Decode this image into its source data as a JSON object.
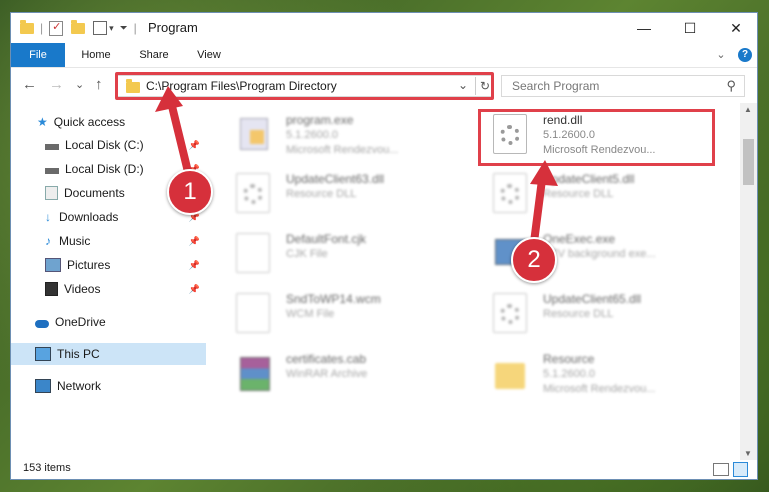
{
  "window": {
    "title": "Program",
    "controls": {
      "minimize": "—",
      "maximize": "☐",
      "close": "✕"
    }
  },
  "ribbon": {
    "tabs": [
      "File",
      "Home",
      "Share",
      "View"
    ],
    "expand": "⌄",
    "help": "?"
  },
  "nav": {
    "back": "←",
    "forward": "→",
    "recent": "⌄",
    "up": "↑",
    "address": "C:\\Program Files\\Program Directory",
    "refresh": "↻",
    "search_placeholder": "Search Program"
  },
  "sidebar": {
    "items": [
      {
        "label": "Quick access",
        "icon": "star-icon",
        "pinned": false
      },
      {
        "label": "Local Disk (C:)",
        "icon": "drive-icon",
        "pinned": true
      },
      {
        "label": "Local Disk (D:)",
        "icon": "drive-icon",
        "pinned": true
      },
      {
        "label": "Documents",
        "icon": "documents-icon",
        "pinned": true
      },
      {
        "label": "Downloads",
        "icon": "download-icon",
        "pinned": true
      },
      {
        "label": "Music",
        "icon": "music-icon",
        "pinned": true
      },
      {
        "label": "Pictures",
        "icon": "pictures-icon",
        "pinned": true
      },
      {
        "label": "Videos",
        "icon": "video-icon",
        "pinned": true
      },
      {
        "label": "OneDrive",
        "icon": "cloud-icon",
        "pinned": false
      },
      {
        "label": "This PC",
        "icon": "computer-icon",
        "pinned": false,
        "selected": true
      },
      {
        "label": "Network",
        "icon": "network-icon",
        "pinned": false
      }
    ]
  },
  "files": [
    {
      "name": "program.exe",
      "line1": "5.1.2600.0",
      "line2": "Microsoft Rendezvou...",
      "type": "exe"
    },
    {
      "name": "rend.dll",
      "line1": "5.1.2600.0",
      "line2": "Microsoft Rendezvou...",
      "type": "dll"
    },
    {
      "name": "UpdateClient63.dll",
      "line1": "Resource DLL",
      "line2": "",
      "type": "dll"
    },
    {
      "name": "UpdateClient5.dll",
      "line1": "Resource DLL",
      "line2": "",
      "type": "dll"
    },
    {
      "name": "DefaultFont.cjk",
      "line1": "CJK File",
      "line2": "",
      "type": "doc"
    },
    {
      "name": "OneExec.exe",
      "line1": "DTV background exe...",
      "line2": "",
      "type": "exe2"
    },
    {
      "name": "SndToWP14.wcm",
      "line1": "WCM File",
      "line2": "",
      "type": "doc"
    },
    {
      "name": "UpdateClient65.dll",
      "line1": "Resource DLL",
      "line2": "",
      "type": "dll"
    },
    {
      "name": "certificates.cab",
      "line1": "WinRAR Archive",
      "line2": "",
      "type": "rar"
    },
    {
      "name": "Resource",
      "line1": "5.1.2600.0",
      "line2": "Microsoft Rendezvou...",
      "type": "folder"
    }
  ],
  "status": {
    "count": "153 items"
  },
  "callouts": {
    "one": "1",
    "two": "2"
  },
  "colors": {
    "accent": "#1979ca",
    "highlight": "#e0404a",
    "selected": "#cce4f7"
  }
}
